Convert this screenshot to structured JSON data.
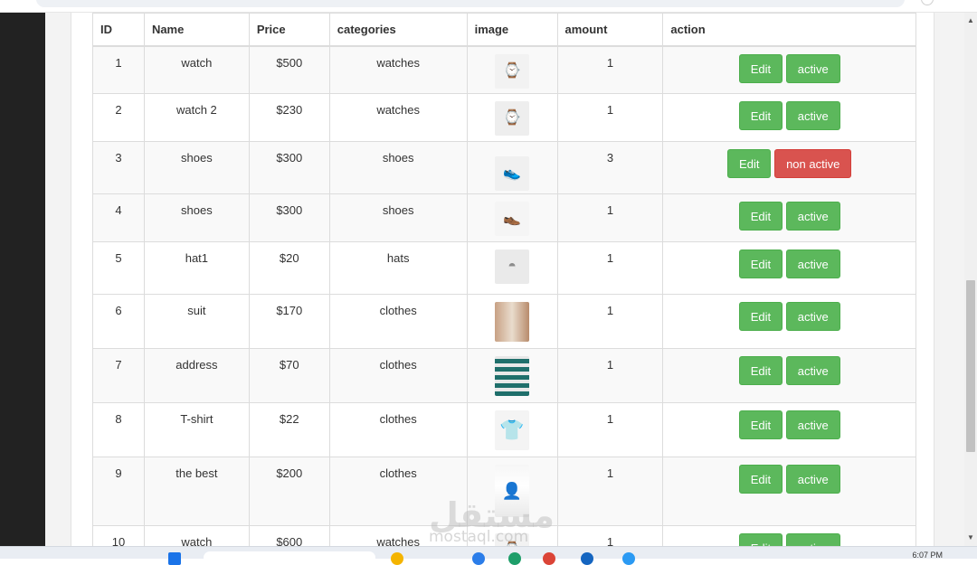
{
  "table": {
    "headers": [
      "ID",
      "Name",
      "Price",
      "categories",
      "image",
      "amount",
      "action"
    ],
    "rows": [
      {
        "id": "1",
        "name": "watch",
        "price": "$500",
        "category": "watches",
        "image": "watch-silver-image",
        "amount": "1",
        "edit": "Edit",
        "status": "active",
        "status_color": "#5cb85c"
      },
      {
        "id": "2",
        "name": "watch 2",
        "price": "$230",
        "category": "watches",
        "image": "watch-dark-image",
        "amount": "1",
        "edit": "Edit",
        "status": "active",
        "status_color": "#5cb85c"
      },
      {
        "id": "3",
        "name": "shoes",
        "price": "$300",
        "category": "shoes",
        "image": "sneaker-black-image",
        "amount": "3",
        "edit": "Edit",
        "status": "non active",
        "status_color": "#d9534f"
      },
      {
        "id": "4",
        "name": "shoes",
        "price": "$300",
        "category": "shoes",
        "image": "shoes-brown-image",
        "amount": "1",
        "edit": "Edit",
        "status": "active",
        "status_color": "#5cb85c"
      },
      {
        "id": "5",
        "name": "hat1",
        "price": "$20",
        "category": "hats",
        "image": "beanie-grey-image",
        "amount": "1",
        "edit": "Edit",
        "status": "active",
        "status_color": "#5cb85c"
      },
      {
        "id": "6",
        "name": "suit",
        "price": "$170",
        "category": "clothes",
        "image": "suit-model-image",
        "amount": "1",
        "edit": "Edit",
        "status": "active",
        "status_color": "#5cb85c"
      },
      {
        "id": "7",
        "name": "address",
        "price": "$70",
        "category": "clothes",
        "image": "patterned-dress-image",
        "amount": "1",
        "edit": "Edit",
        "status": "active",
        "status_color": "#5cb85c"
      },
      {
        "id": "8",
        "name": "T-shirt",
        "price": "$22",
        "category": "clothes",
        "image": "tshirt-black-image",
        "amount": "1",
        "edit": "Edit",
        "status": "active",
        "status_color": "#5cb85c"
      },
      {
        "id": "9",
        "name": "the best",
        "price": "$200",
        "category": "clothes",
        "image": "tshirt-white-model-image",
        "amount": "1",
        "edit": "Edit",
        "status": "active",
        "status_color": "#5cb85c"
      },
      {
        "id": "10",
        "name": "watch",
        "price": "$600",
        "category": "watches",
        "image": "watch-image",
        "amount": "1",
        "edit": "Edit",
        "status": "active",
        "status_color": "#5cb85c"
      }
    ]
  },
  "watermark": {
    "arabic": "مستقل",
    "latin": "mostaql.com"
  },
  "taskbar": {
    "clock": "6:07 PM"
  },
  "colors": {
    "success": "#5cb85c",
    "danger": "#d9534f",
    "border": "#dcdcdc",
    "stripe": "#f9f9f9"
  }
}
